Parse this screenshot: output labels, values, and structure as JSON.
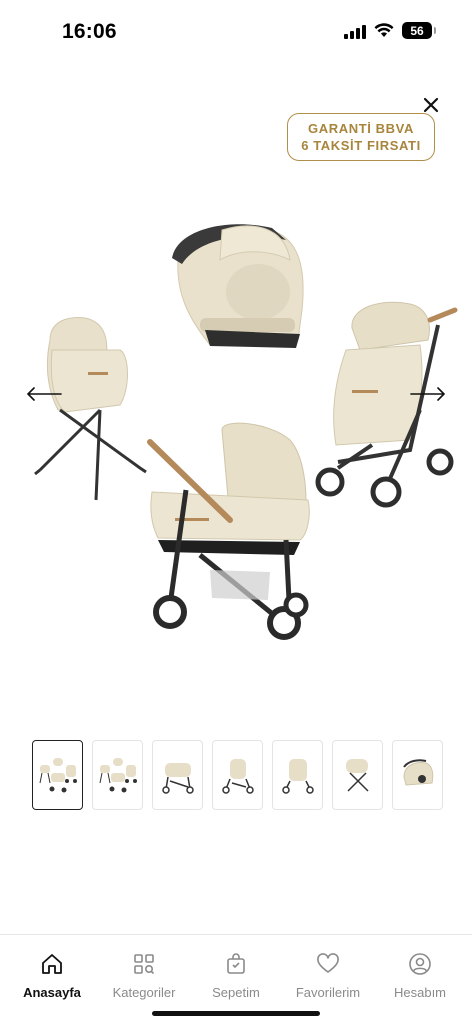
{
  "status_bar": {
    "time": "16:06",
    "battery": "56"
  },
  "promo": {
    "line1": "GARANTİ BBVA",
    "line2": "6 TAKSİT FIRSATI"
  },
  "gallery": {
    "thumbnails": [
      {
        "icon": "travel-system-thumb",
        "active": true
      },
      {
        "icon": "travel-system-thumb",
        "active": false
      },
      {
        "icon": "carrycot-stroller-thumb",
        "active": false
      },
      {
        "icon": "stroller-thumb",
        "active": false
      },
      {
        "icon": "stroller-footmuff-thumb",
        "active": false
      },
      {
        "icon": "bassinet-stand-thumb",
        "active": false
      },
      {
        "icon": "car-seat-thumb",
        "active": false
      }
    ]
  },
  "nav": {
    "items": [
      {
        "label": "Anasayfa",
        "icon": "home-icon",
        "active": true
      },
      {
        "label": "Kategoriler",
        "icon": "categories-icon",
        "active": false
      },
      {
        "label": "Sepetim",
        "icon": "bag-icon",
        "active": false
      },
      {
        "label": "Favorilerim",
        "icon": "heart-icon",
        "active": false
      },
      {
        "label": "Hesabım",
        "icon": "account-icon",
        "active": false
      }
    ]
  },
  "colors": {
    "accent": "#a8853d",
    "fabric": "#ece4cf",
    "frame": "#2e2e2e"
  }
}
